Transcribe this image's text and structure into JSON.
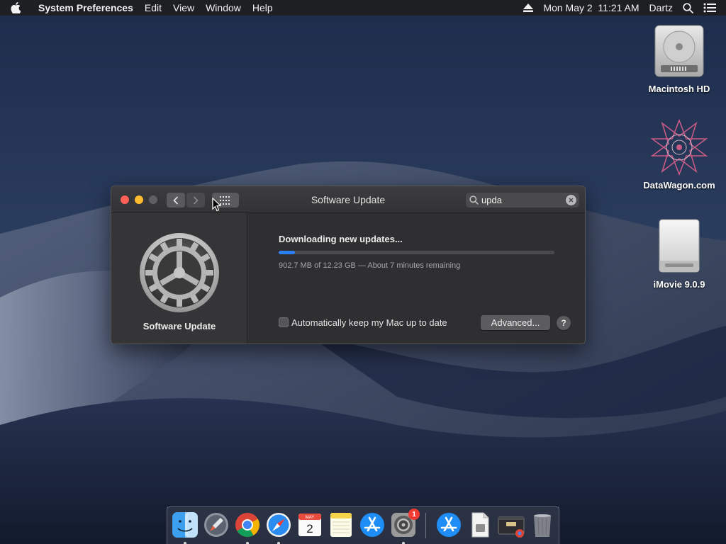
{
  "menubar": {
    "app_name": "System Preferences",
    "menus": [
      "Edit",
      "View",
      "Window",
      "Help"
    ],
    "clock": "Mon May 2  11:21 AM",
    "user": "Dartz"
  },
  "desktop": {
    "icons": [
      {
        "label": "Macintosh HD",
        "icon": "hard-drive-icon"
      },
      {
        "label": "DataWagon.com",
        "icon": "datawagon-emblem-icon"
      },
      {
        "label": "iMovie 9.0.9",
        "icon": "disk-image-icon"
      }
    ]
  },
  "window": {
    "title": "Software Update",
    "search": {
      "value": "upda",
      "placeholder": "Search"
    },
    "pane_name": "Software Update",
    "status_title": "Downloading new updates...",
    "progress_fraction": 0.06,
    "progress_text": "902.7 MB of 12.23 GB — About 7 minutes remaining",
    "auto_update_label": "Automatically keep my Mac up to date",
    "auto_update_checked": false,
    "advanced_label": "Advanced...",
    "help_label": "?"
  },
  "dock": {
    "items": [
      {
        "name": "Finder",
        "icon": "finder-icon",
        "running": true
      },
      {
        "name": "Launchpad",
        "icon": "launchpad-icon",
        "running": false
      },
      {
        "name": "Chrome",
        "icon": "chrome-icon",
        "running": true
      },
      {
        "name": "Safari",
        "icon": "safari-icon",
        "running": true
      },
      {
        "name": "Calendar",
        "icon": "calendar-icon",
        "running": false,
        "month": "MAY",
        "day": "2"
      },
      {
        "name": "Notes",
        "icon": "notes-icon",
        "running": false
      },
      {
        "name": "App Store",
        "icon": "app-store-icon",
        "running": false
      },
      {
        "name": "System Preferences",
        "icon": "system-preferences-icon",
        "running": true,
        "badge": "1"
      },
      {
        "name": "App Store Download",
        "icon": "app-store-download-icon",
        "running": false
      },
      {
        "name": "Document",
        "icon": "document-icon",
        "running": false
      },
      {
        "name": "Chrome Window",
        "icon": "window-thumbnail-icon",
        "running": false
      },
      {
        "name": "Trash",
        "icon": "trash-icon",
        "running": false
      }
    ]
  },
  "colors": {
    "accent": "#2a7ff2",
    "window_bg": "#2f2f31",
    "close": "#fe5f57",
    "minimize": "#febc2e",
    "zoom_disabled": "#5f5f61"
  }
}
